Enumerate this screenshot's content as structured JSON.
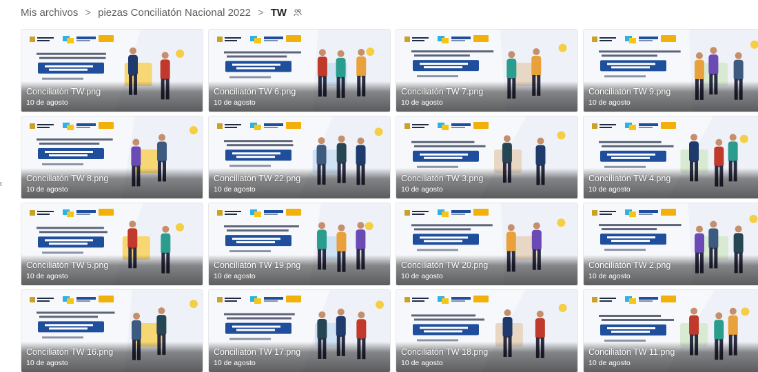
{
  "breadcrumb": {
    "items": [
      "Mis archivos",
      "piezas Conciliatón Nacional 2022"
    ],
    "current": "TW",
    "separator": ">"
  },
  "left_edge_text": "t",
  "colors": {
    "accent_blue": "#1f4e9c",
    "accent_yellow": "#f5c518",
    "accent_cyan": "#2eb2e5",
    "tile_bg": "#f4f6f9"
  },
  "files": [
    {
      "name": "Conciliatón TW.png",
      "date": "10 de agosto"
    },
    {
      "name": "Conciliatón TW 6.png",
      "date": "10 de agosto"
    },
    {
      "name": "Conciliatón TW 7.png",
      "date": "10 de agosto"
    },
    {
      "name": "Conciliatón TW 9.png",
      "date": "10 de agosto"
    },
    {
      "name": "Conciliatón TW 8.png",
      "date": "10 de agosto"
    },
    {
      "name": "Conciliatón TW 22.png",
      "date": "10 de agosto"
    },
    {
      "name": "Conciliatón TW 3.png",
      "date": "10 de agosto"
    },
    {
      "name": "Conciliatón TW 4.png",
      "date": "10 de agosto"
    },
    {
      "name": "Conciliatón TW 5.png",
      "date": "10 de agosto"
    },
    {
      "name": "Conciliatón TW 19.png",
      "date": "10 de agosto"
    },
    {
      "name": "Conciliatón TW 20.png",
      "date": "10 de agosto"
    },
    {
      "name": "Conciliatón TW 2.png",
      "date": "10 de agosto"
    },
    {
      "name": "Conciliatón TW 16.png",
      "date": "10 de agosto"
    },
    {
      "name": "Conciliatón TW 17.png",
      "date": "10 de agosto"
    },
    {
      "name": "Conciliatón TW 18.png",
      "date": "10 de agosto"
    },
    {
      "name": "Conciliatón TW 11.png",
      "date": "10 de agosto"
    }
  ]
}
